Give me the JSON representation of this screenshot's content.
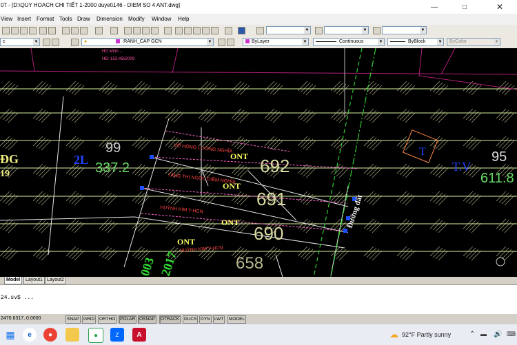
{
  "window": {
    "title": "07 - [D:\\QUY HOACH CHI TIẾT 1-2000 duyet\\146 - DIEM SO 4 ANT.dwg]",
    "minimize_icon": "minimize-icon",
    "maximize_icon": "maximize-icon",
    "close_icon": "close-icon"
  },
  "menu": {
    "items": [
      "View",
      "Insert",
      "Format",
      "Tools",
      "Draw",
      "Dimension",
      "Modify",
      "Window",
      "Help"
    ]
  },
  "toolbar": {
    "layer_value": "RANH_CAP GCN",
    "color_value": "ByLayer",
    "linetype_value": "Continuous",
    "lineweight_value": "ByBlock",
    "plotstyle_value": "ByColor",
    "left_combo_value": "c",
    "layer_color": "#cc33cc"
  },
  "drawing": {
    "background": "#000000",
    "labels": {
      "owner_top": "HO Minh ...",
      "sheet_ref": "HĐ: 153-AB/2009",
      "lot_left_num": "99",
      "lot_left_area": "337.2",
      "lot_left_code": "ĐG",
      "lot_left_code2": "19",
      "lot_left_tag": "2L",
      "lot_692": "692",
      "lot_691": "691",
      "lot_690": "690",
      "lot_658": "658",
      "ont_1": "ONT",
      "ont_2": "ONT",
      "ont_3": "ONT",
      "ont_4": "ONT",
      "owner_1": "VÕ HÒNG LƯƠNG NGHĨA",
      "owner_2": "TĂNG THỊ NGỌC DIỄM NGHĨA",
      "owner_3": "HUỲNH KIM Y-HCN",
      "owner_4": "HUỲNH KIM Y-HCN",
      "road": "Đường đất",
      "year_1": "003",
      "year_2": "2017",
      "right_num": "95",
      "right_area": "611.8",
      "right_code": "T.V",
      "right_t": "T"
    }
  },
  "tabs": [
    "Model",
    "Layout1",
    "Layout2"
  ],
  "command": {
    "line1": "24.sv$ ..."
  },
  "status": {
    "coords": "2470.6317, 0.0000",
    "buttons": [
      "SNAP",
      "GRID",
      "ORTHO",
      "POLAR",
      "OSNAP",
      "OTRACK",
      "DUCS",
      "DYN",
      "LWT",
      "MODEL"
    ]
  },
  "taskbar": {
    "weather": "92°F  Partly sunny",
    "icons": [
      "start-icon",
      "search-icon",
      "edge-icon",
      "chrome-icon",
      "file-explorer-icon",
      "zalo-icon",
      "coccoc-icon",
      "autocad-icon"
    ]
  }
}
